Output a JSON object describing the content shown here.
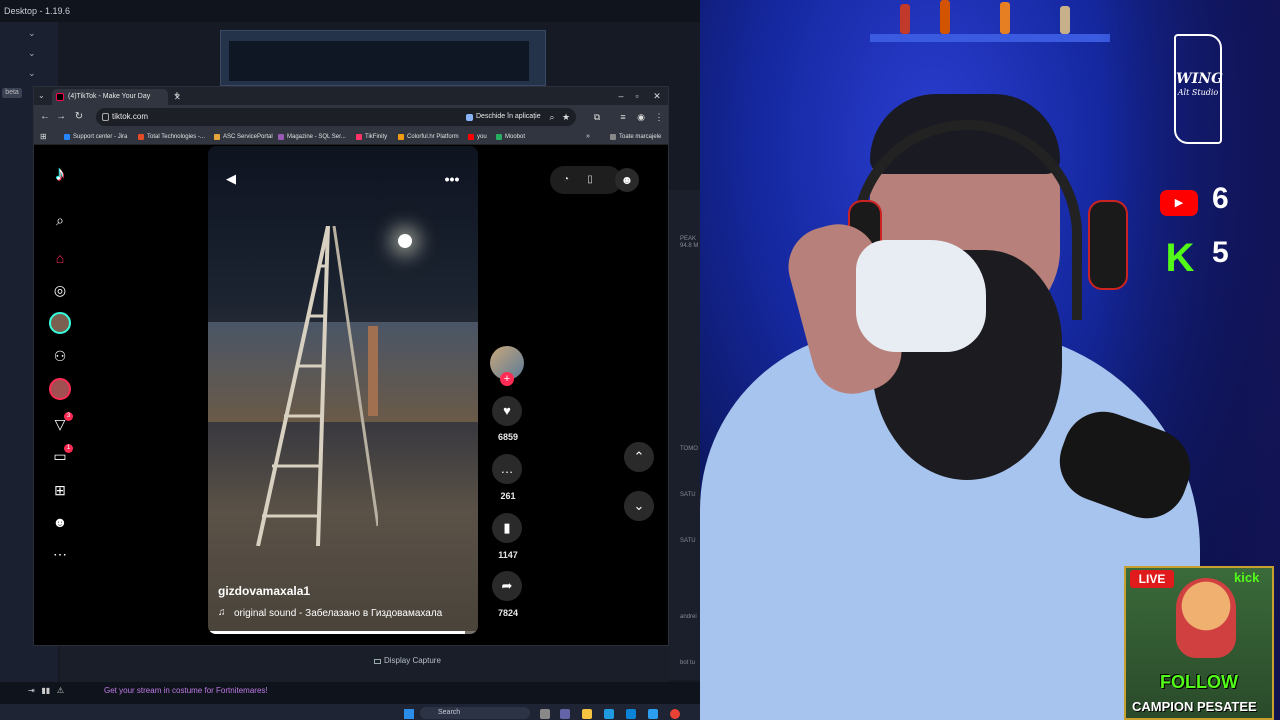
{
  "desktop": {
    "title": "Desktop - 1.19.6",
    "beta_label": "beta",
    "display_capture_label": "Display Capture",
    "status_message": "Get your stream in costume for Fortnitemares!",
    "taskbar_search": "Search",
    "side_labels": [
      "PEAK",
      "94.8 M",
      "TOMO",
      "SATU",
      "SATU",
      "andrei",
      "bot tu"
    ]
  },
  "browser": {
    "tab_title": "(4)TikTok - Make Your Day",
    "url": "tiktok.com",
    "open_in_app_label": "Deschide în aplicație",
    "bookmarks": [
      {
        "label": "Support center - Jira",
        "color": "#2684ff"
      },
      {
        "label": "Total Technologies -...",
        "color": "#e34c26"
      },
      {
        "label": "ASC ServicePortal",
        "color": "#e8a33a"
      },
      {
        "label": "Magazine - SQL Ser...",
        "color": "#9b59b6"
      },
      {
        "label": "TikFinity",
        "color": "#ff3366"
      },
      {
        "label": "Colorful.hr Platform",
        "color": "#f39c12"
      },
      {
        "label": "you",
        "color": "#ff0000"
      },
      {
        "label": "Moobot",
        "color": "#27ae60"
      }
    ],
    "all_bookmarks_label": "Toate marcajele"
  },
  "tiktok": {
    "sidebar_badges": {
      "activity": "3",
      "messages": "1"
    },
    "video": {
      "author": "gizdovamaxala1",
      "sound": "original sound - Забелазано в Гиздовамахала",
      "progress": 0.95
    },
    "actions": {
      "likes": "6859",
      "comments": "261",
      "saves": "1147",
      "shares": "7824"
    }
  },
  "overlay": {
    "brand_name": "WING",
    "brand_sub": "Alt Studio",
    "youtube_count": "6",
    "kick_count": "5",
    "live_label": "LIVE",
    "kick_label": "kick",
    "follow_label": "FOLLOW",
    "campion_label": "CAMPION PESATEE"
  }
}
